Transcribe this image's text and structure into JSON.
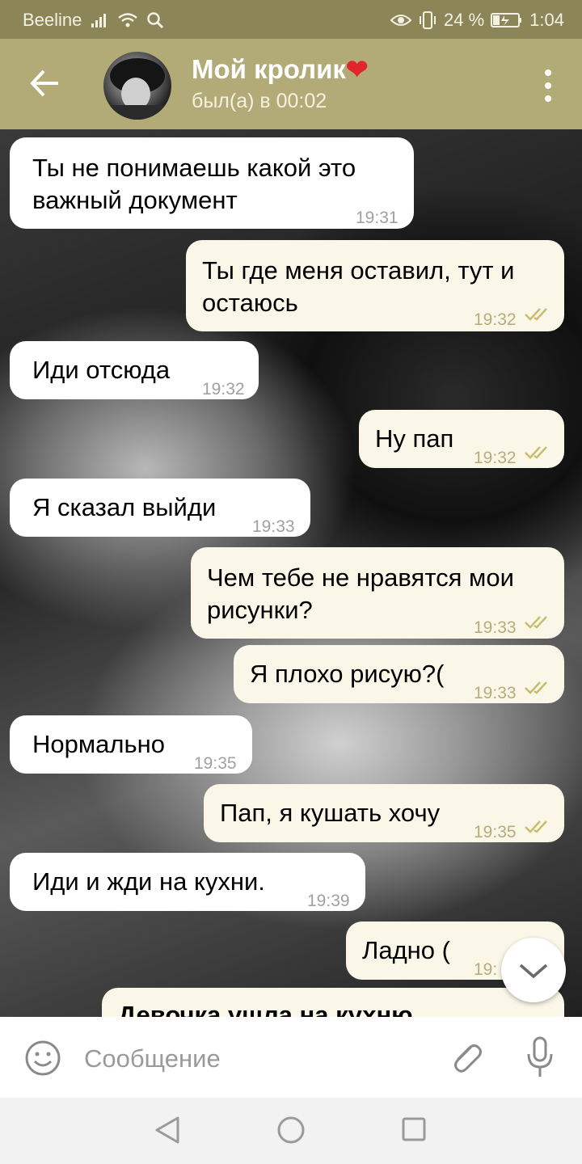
{
  "status_bar": {
    "carrier": "Beeline",
    "battery_percent": "24 %",
    "time": "1:04"
  },
  "header": {
    "title": "Мой кролик",
    "title_emoji": "❤",
    "subtitle": "был(а) в 00:02",
    "back_icon": "arrow-left-icon",
    "menu_icon": "more-vertical-icon"
  },
  "messages": [
    {
      "direction": "in",
      "line1": "Ты не понимаешь какой это",
      "line2": "важный документ",
      "time": "19:31"
    },
    {
      "direction": "out",
      "line1": "Ты где меня оставил, тут и",
      "line2": "остаюсь",
      "time": "19:32",
      "read": true
    },
    {
      "direction": "in",
      "line1": "Иди отсюда",
      "time": "19:32"
    },
    {
      "direction": "out",
      "line1": "Ну пап",
      "time": "19:32",
      "read": true
    },
    {
      "direction": "in",
      "line1": "Я сказал выйди",
      "time": "19:33"
    },
    {
      "direction": "out",
      "line1": "Чем тебе не нравятся мои",
      "line2": "рисунки?",
      "time": "19:33",
      "read": true
    },
    {
      "direction": "out",
      "line1": "Я плохо рисую?(",
      "time": "19:33",
      "read": true
    },
    {
      "direction": "in",
      "line1": "Нормально",
      "time": "19:35"
    },
    {
      "direction": "out",
      "line1": "Пап, я кушать хочу",
      "time": "19:35",
      "read": true
    },
    {
      "direction": "in",
      "line1": "Иди и жди на кухни.",
      "time": "19:39"
    },
    {
      "direction": "out",
      "line1": "Ладно (",
      "time": "19:",
      "read": true
    },
    {
      "direction": "out",
      "line1": "Девочка ушла на кухню",
      "partial": true
    }
  ],
  "input": {
    "placeholder": "Сообщение",
    "emoji_icon": "emoji-icon",
    "attach_icon": "paperclip-icon",
    "mic_icon": "microphone-icon"
  },
  "colors": {
    "status_bar_bg": "#8c8557",
    "header_bg": "#b2ab77",
    "outgoing_bubble": "#fbf7e8",
    "incoming_bubble": "#ffffff",
    "check_color": "#c8bc6e"
  }
}
